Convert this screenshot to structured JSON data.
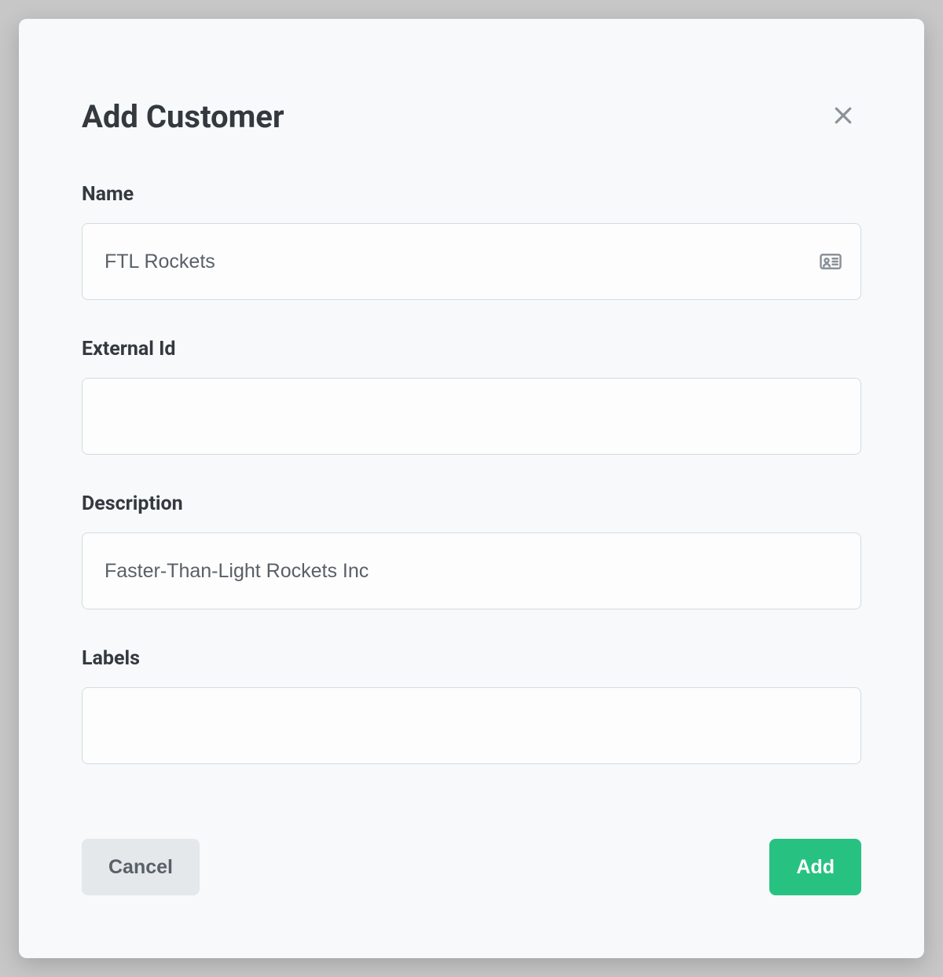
{
  "modal": {
    "title": "Add Customer"
  },
  "fields": {
    "name": {
      "label": "Name",
      "value": "FTL Rockets"
    },
    "external_id": {
      "label": "External Id",
      "value": ""
    },
    "description": {
      "label": "Description",
      "value": "Faster-Than-Light Rockets Inc"
    },
    "labels": {
      "label": "Labels",
      "value": ""
    }
  },
  "actions": {
    "cancel": "Cancel",
    "add": "Add"
  }
}
